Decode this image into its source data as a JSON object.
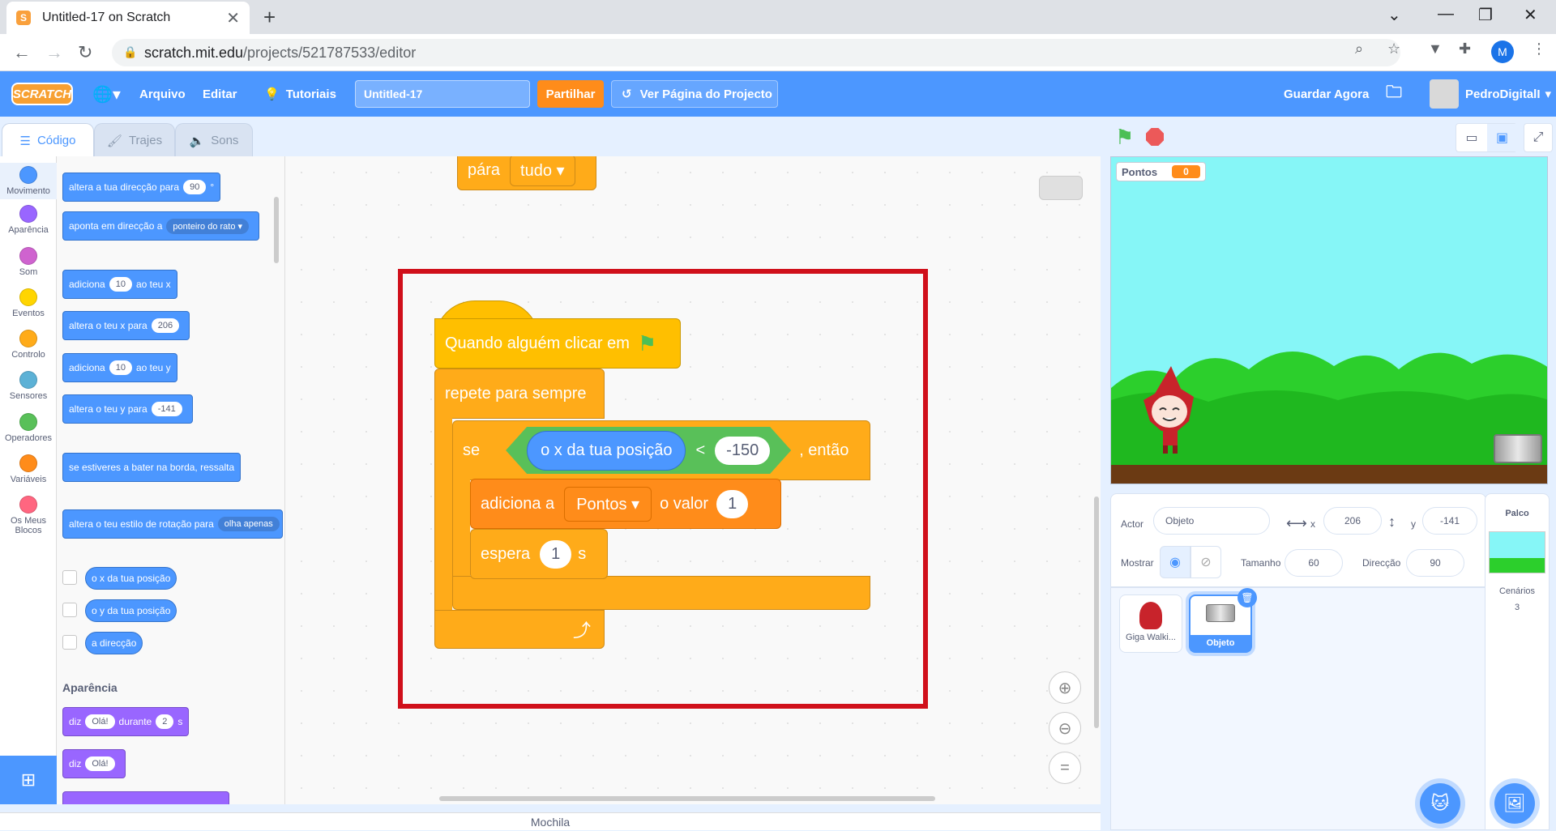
{
  "browser": {
    "tab_title": "Untitled-17 on Scratch",
    "url_host": "scratch.mit.edu",
    "url_path": "/projects/521787533/editor",
    "profile_initial": "M"
  },
  "menubar": {
    "logo": "SCRATCH",
    "file": "Arquivo",
    "edit": "Editar",
    "tutorials": "Tutoriais",
    "project_title": "Untitled-17",
    "share": "Partilhar",
    "project_page": "Ver Página do Projecto",
    "save_now": "Guardar Agora",
    "username": "PedroDigitalI"
  },
  "editor_tabs": {
    "code": "Código",
    "costumes": "Trajes",
    "sounds": "Sons"
  },
  "categories": [
    {
      "label": "Movimento",
      "color": "#4c97ff"
    },
    {
      "label": "Aparência",
      "color": "#9966ff"
    },
    {
      "label": "Som",
      "color": "#cf63cf"
    },
    {
      "label": "Eventos",
      "color": "#ffd500"
    },
    {
      "label": "Controlo",
      "color": "#ffab19"
    },
    {
      "label": "Sensores",
      "color": "#5cb1d6"
    },
    {
      "label": "Operadores",
      "color": "#59c059"
    },
    {
      "label": "Variáveis",
      "color": "#ff8c1a"
    },
    {
      "label": "Os Meus Blocos",
      "color": "#ff6680"
    }
  ],
  "palette": {
    "point_dir_text": "altera a tua direcção para",
    "point_dir_val": "90",
    "point_dir_unit": "°",
    "point_towards_text": "aponta em direcção a",
    "point_towards_val": "ponteiro do rato",
    "change_x_a": "adiciona",
    "change_x_val": "10",
    "change_x_b": "ao teu x",
    "set_x_text": "altera o teu x para",
    "set_x_val": "206",
    "change_y_a": "adiciona",
    "change_y_val": "10",
    "change_y_b": "ao teu y",
    "set_y_text": "altera o teu y para",
    "set_y_val": "-141",
    "bounce": "se estiveres a bater na borda, ressalta",
    "rotation_text": "altera o teu estilo de rotação para",
    "rotation_val": "olha apenas",
    "rep_x": "o x da tua posição",
    "rep_y": "o y da tua posição",
    "rep_dir": "a direcção",
    "looks_header": "Aparência",
    "say_for_a": "diz",
    "say_for_val": "Olá!",
    "say_for_b": "durante",
    "say_for_secs": "2",
    "say_for_c": "s",
    "say_a": "diz",
    "say_val": "Olá!"
  },
  "script": {
    "stop_label": "pára",
    "stop_value": "tudo",
    "hat_label": "Quando alguém clicar em",
    "forever_label": "repete para sempre",
    "if_label": "se",
    "then_label": ", então",
    "cond_reporter": "o x da tua posição",
    "cond_op": "<",
    "cond_value": "-150",
    "change_var_a": "adiciona a",
    "change_var_name": "Pontos",
    "change_var_b": "o valor",
    "change_var_value": "1",
    "wait_label": "espera",
    "wait_value": "1",
    "wait_unit": "s"
  },
  "stage": {
    "var_name": "Pontos",
    "var_value": "0"
  },
  "sprite_info": {
    "actor_label": "Actor",
    "actor_name": "Objeto",
    "x_label": "x",
    "x_value": "206",
    "y_label": "y",
    "y_value": "-141",
    "show_label": "Mostrar",
    "size_label": "Tamanho",
    "size_value": "60",
    "direction_label": "Direcção",
    "direction_value": "90"
  },
  "sprites": [
    {
      "name": "Giga Walki..."
    },
    {
      "name": "Objeto"
    }
  ],
  "stage_pane": {
    "title": "Palco",
    "backdrops_label": "Cenários",
    "backdrops_count": "3"
  },
  "backpack": "Mochila",
  "colors": {
    "scratch_blue": "#4c97ff",
    "highlight_red": "#d0101b"
  }
}
